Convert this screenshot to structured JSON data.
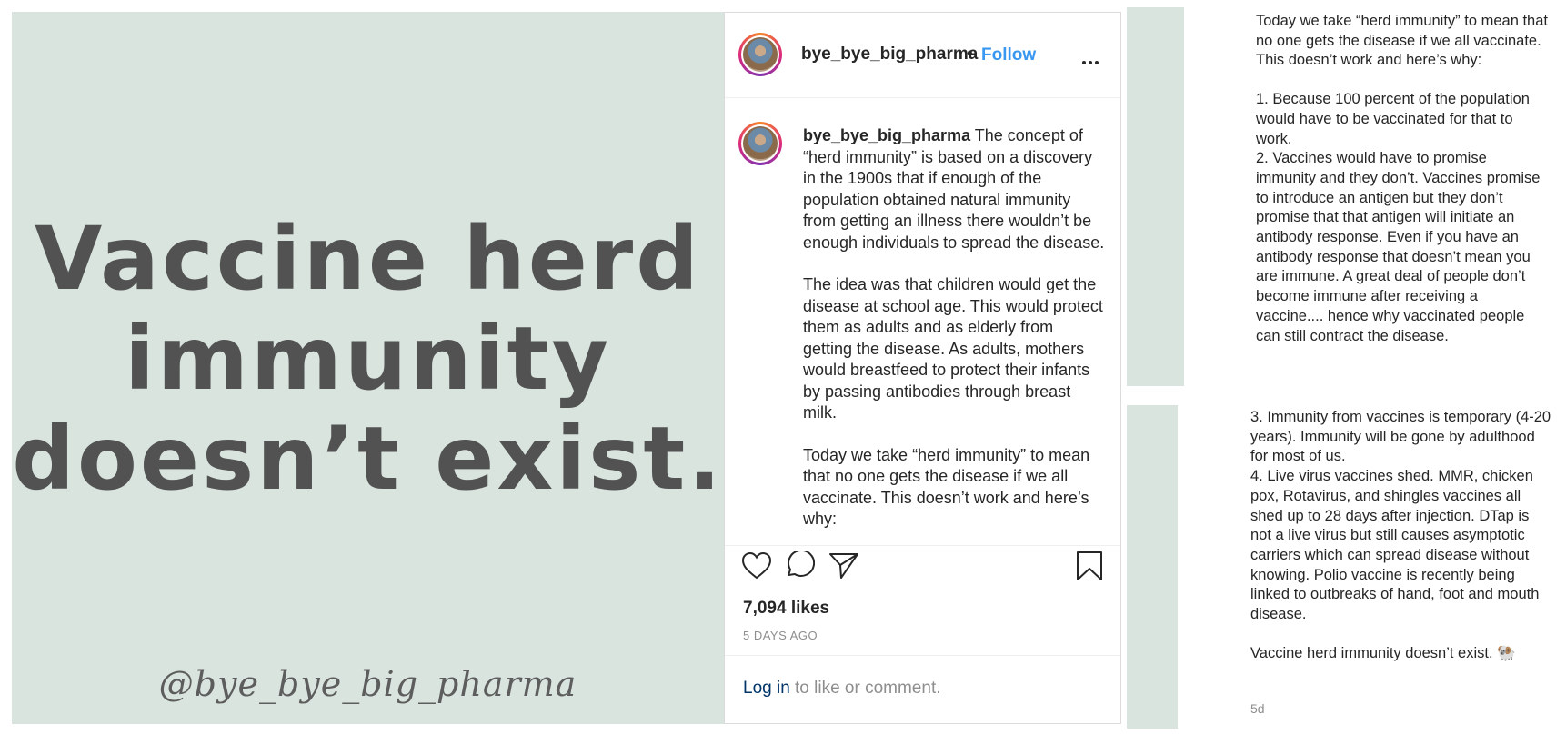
{
  "image": {
    "headline_lines": [
      "Vaccine herd",
      "immunity",
      "doesn’t exist."
    ],
    "handle_script": "@bye_bye_big_pharma",
    "background": "#d8e4dd"
  },
  "header": {
    "username": "bye_bye_big_pharma",
    "separator": "•",
    "follow_label": "Follow",
    "more_icon": "more-horizontal-icon"
  },
  "caption": {
    "username": "bye_bye_big_pharma",
    "p1": "The concept of “herd immunity” is based on a discovery in the 1900s that if enough of the population obtained natural immunity from getting an illness there wouldn’t be enough individuals to spread the disease.",
    "p2": "The idea was that children would get the disease at school age. This would protect them as adults and as elderly from getting the disease. As adults, mothers would breastfeed to protect their infants by passing antibodies through breast milk.",
    "p3": "Today we take “herd immunity” to mean that no one gets the disease if we all vaccinate. This doesn’t work and here’s why:"
  },
  "actions": {
    "icons": [
      "heart-icon",
      "comment-icon",
      "share-icon",
      "bookmark-icon"
    ],
    "likes": "7,094 likes",
    "time_ago": "5 DAYS AGO"
  },
  "login": {
    "link": "Log in",
    "rest": "to like or comment."
  },
  "side_text_1": {
    "intro": "Today we take “herd immunity” to mean that no one gets the disease if we all vaccinate. This doesn’t work and here’s why:",
    "point1": "1. Because 100 percent of the population would have to be vaccinated for that to work.",
    "point2": "2. Vaccines would have to promise immunity and they don’t. Vaccines promise to introduce an antigen but they don’t promise that that antigen will initiate an antibody response. Even if you have an antibody response that doesn’t mean you are immune. A great deal of people don’t become immune after receiving a vaccine.... hence why vaccinated people can still contract the disease."
  },
  "side_text_2": {
    "point3": "3. Immunity from vaccines is temporary (4-20 years). Immunity will be gone by adulthood for most of us.",
    "point4": "4. Live virus vaccines shed. MMR, chicken pox, Rotavirus, and shingles vaccines all shed up to 28 days after injection. DTap is not a live virus but still causes asymptotic carriers which can spread disease without knowing. Polio vaccine is recently being linked to outbreaks of hand, foot and mouth disease.",
    "closing": "Vaccine herd immunity doesn’t exist. 🐏",
    "time": "5d"
  }
}
